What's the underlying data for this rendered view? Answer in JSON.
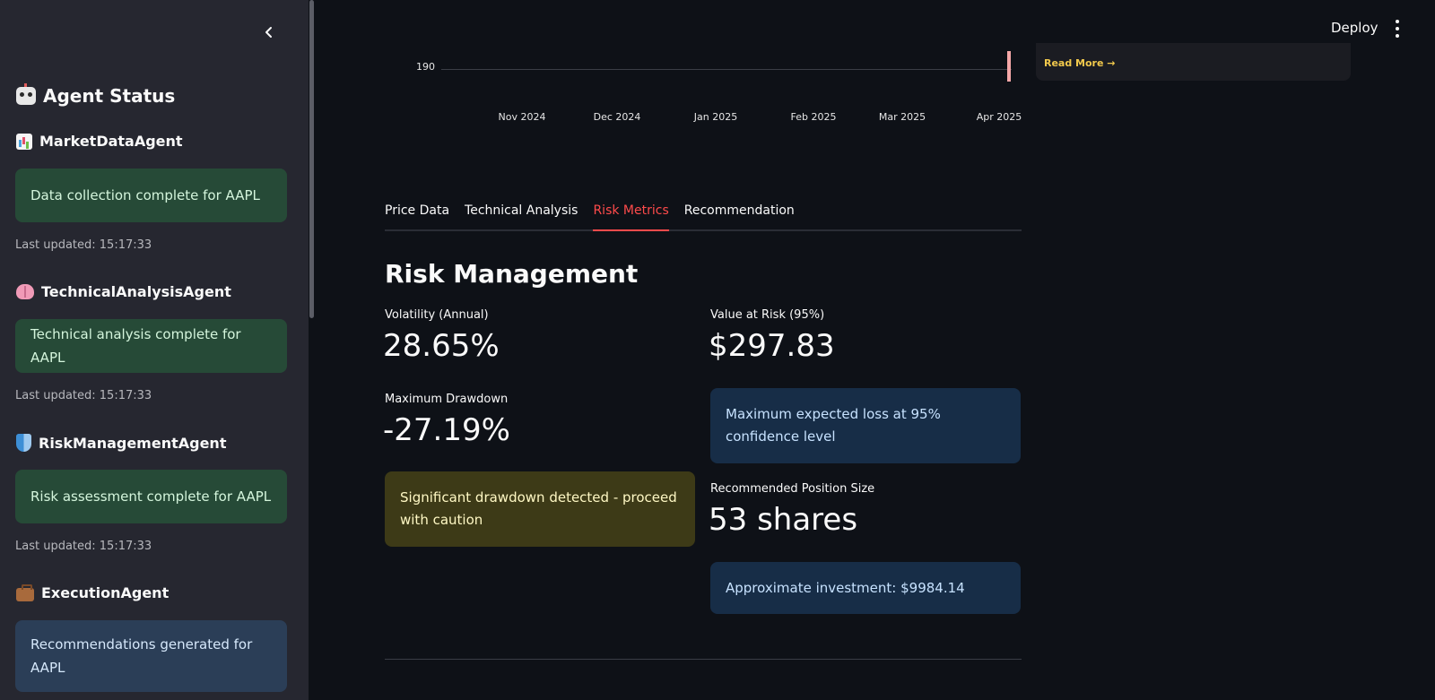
{
  "sidebar": {
    "title": "Agent Status",
    "agents": [
      {
        "name": "MarketDataAgent",
        "icon": "bar-chart-icon",
        "message": "Data collection complete for AAPL",
        "status": "success",
        "last_updated": "Last updated: 15:17:33"
      },
      {
        "name": "TechnicalAnalysisAgent",
        "icon": "brain-icon",
        "message": "Technical analysis complete for AAPL",
        "status": "success",
        "last_updated": "Last updated: 15:17:33"
      },
      {
        "name": "RiskManagementAgent",
        "icon": "shield-icon",
        "message": "Risk assessment complete for AAPL",
        "status": "success",
        "last_updated": "Last updated: 15:17:33"
      },
      {
        "name": "ExecutionAgent",
        "icon": "briefcase-icon",
        "message": "Recommendations generated for AAPL",
        "status": "info"
      }
    ]
  },
  "header": {
    "deploy_label": "Deploy"
  },
  "chart_data": {
    "type": "line",
    "x_ticks": [
      "Nov 2024",
      "Dec 2024",
      "Jan 2025",
      "Feb 2025",
      "Mar 2025",
      "Apr 2025"
    ],
    "y_ticks": [
      "190"
    ]
  },
  "news": {
    "read_more": "Read More →"
  },
  "tabs": [
    {
      "label": "Price Data",
      "active": false
    },
    {
      "label": "Technical Analysis",
      "active": false
    },
    {
      "label": "Risk Metrics",
      "active": true
    },
    {
      "label": "Recommendation",
      "active": false
    }
  ],
  "risk": {
    "title": "Risk Management",
    "volatility_label": "Volatility (Annual)",
    "volatility_value": "28.65%",
    "max_drawdown_label": "Maximum Drawdown",
    "max_drawdown_value": "-27.19%",
    "drawdown_warning": "Significant drawdown detected - proceed with caution",
    "var_label": "Value at Risk (95%)",
    "var_value": "$297.83",
    "var_info": "Maximum expected loss at 95% confidence level",
    "position_label": "Recommended Position Size",
    "position_value": "53 shares",
    "investment_info": "Approximate investment: $9984.14"
  },
  "colors": {
    "accent": "#ff4b4b",
    "success_bg": "#264a37",
    "info_bg": "#172d47",
    "warning_bg": "#3d3a17",
    "candle": "#f4a7a7",
    "read_more": "#f2c94c"
  }
}
